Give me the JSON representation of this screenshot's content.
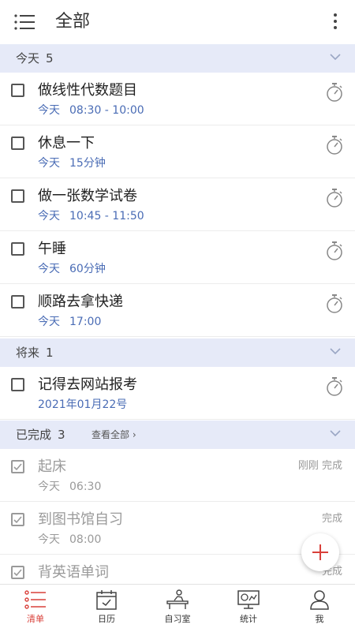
{
  "header": {
    "title": "全部"
  },
  "sections": {
    "today": {
      "title": "今天",
      "count": "5"
    },
    "future": {
      "title": "将来",
      "count": "1"
    },
    "done": {
      "title": "已完成",
      "count": "3",
      "link": "查看全部 ›"
    }
  },
  "today_tasks": [
    {
      "title": "做线性代数题目",
      "date": "今天",
      "time": "08:30 - 10:00"
    },
    {
      "title": "休息一下",
      "date": "今天",
      "time": "15分钟"
    },
    {
      "title": "做一张数学试卷",
      "date": "今天",
      "time": "10:45 - 11:50"
    },
    {
      "title": "午睡",
      "date": "今天",
      "time": "60分钟"
    },
    {
      "title": "顺路去拿快递",
      "date": "今天",
      "time": "17:00"
    }
  ],
  "future_tasks": [
    {
      "title": "记得去网站报考",
      "date": "2021年01月22号"
    }
  ],
  "done_tasks": [
    {
      "title": "起床",
      "date": "今天",
      "time": "06:30",
      "status": "刚刚 完成"
    },
    {
      "title": "到图书馆自习",
      "date": "今天",
      "time": "08:00",
      "status": "完成"
    },
    {
      "title": "背英语单词",
      "status": "完成"
    }
  ],
  "nav": [
    {
      "label": "清单",
      "icon": "checklist-icon"
    },
    {
      "label": "日历",
      "icon": "calendar-icon"
    },
    {
      "label": "自习室",
      "icon": "study-room-icon"
    },
    {
      "label": "统计",
      "icon": "statistics-icon"
    },
    {
      "label": "我",
      "icon": "profile-icon"
    }
  ],
  "colors": {
    "accent": "#d9403a",
    "meta": "#4a6cb5",
    "section_bg": "#e6eaf8"
  }
}
